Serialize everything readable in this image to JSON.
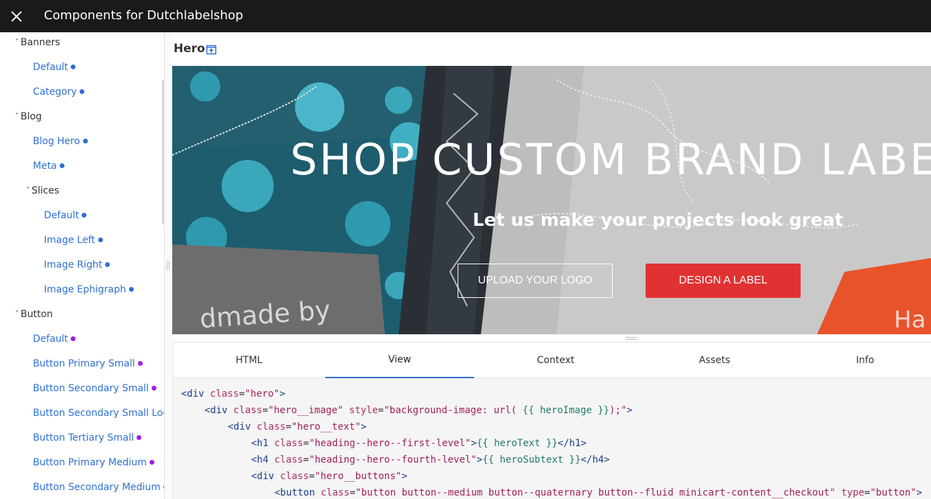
{
  "app": {
    "title": "Components for Dutchlabelshop"
  },
  "sidebar": {
    "groups": [
      {
        "label": "Banners"
      },
      {
        "label": "Blog"
      },
      {
        "label": "Slices"
      },
      {
        "label": "Button"
      }
    ],
    "items": [
      {
        "label": "Default",
        "status": "blue"
      },
      {
        "label": "Category",
        "status": "blue"
      },
      {
        "label": "Blog Hero",
        "status": "blue"
      },
      {
        "label": "Meta",
        "status": "blue"
      },
      {
        "label": "Default",
        "status": "blue"
      },
      {
        "label": "Image Left",
        "status": "blue"
      },
      {
        "label": "Image Right",
        "status": "blue"
      },
      {
        "label": "Image Ephigraph",
        "status": "blue"
      },
      {
        "label": "Default",
        "status": "purple"
      },
      {
        "label": "Button Primary Small",
        "status": "purple"
      },
      {
        "label": "Button Secondary Small",
        "status": "purple"
      },
      {
        "label": "Button Secondary Small Lod",
        "status": "purple"
      },
      {
        "label": "Button Tertiary Small",
        "status": "purple"
      },
      {
        "label": "Button Primary Medium",
        "status": "purple"
      },
      {
        "label": "Button Secondary Medium",
        "status": "purple"
      }
    ]
  },
  "component": {
    "title": "Hero",
    "preview": {
      "heading": "SHOP CUSTOM BRAND LABEL",
      "subheading": "Let us make your projects look great",
      "upload_button": "UPLOAD YOUR LOGO",
      "design_button": "DESIGN A LABEL",
      "fabric_text": "dmade by",
      "fabric_text_2": "Ha"
    }
  },
  "tabs": [
    {
      "label": "HTML"
    },
    {
      "label": "View",
      "active": true
    },
    {
      "label": "Context"
    },
    {
      "label": "Assets"
    },
    {
      "label": "Info"
    }
  ],
  "code": {
    "lines": [
      "<div class=\"hero\">",
      "<div class=\"hero__image\" style=\"background-image: url( {{ heroImage }});\">",
      "<div class=\"hero__text\">",
      "<h1 class=\"heading--hero--first-level\">{{ heroText }}</h1>",
      "<h4 class=\"heading--hero--fourth-level\">{{ heroSubtext }}</h4>",
      "<div class=\"hero__buttons\">",
      "<button class=\"button button--medium button--quaternary button--fluid minicart-content__checkout\" type=\"button\">"
    ]
  },
  "colors": {
    "topbar": "#1a1a1a",
    "link": "#2e6fd3",
    "status_blue": "#2e6fd3",
    "status_purple": "#a01ee8",
    "cta_red": "#e03232",
    "tab_active": "#2e6fd3"
  },
  "icons": {
    "close": "close-icon",
    "open_external": "open-in-new-icon",
    "chevron": "chevron-down-icon"
  }
}
